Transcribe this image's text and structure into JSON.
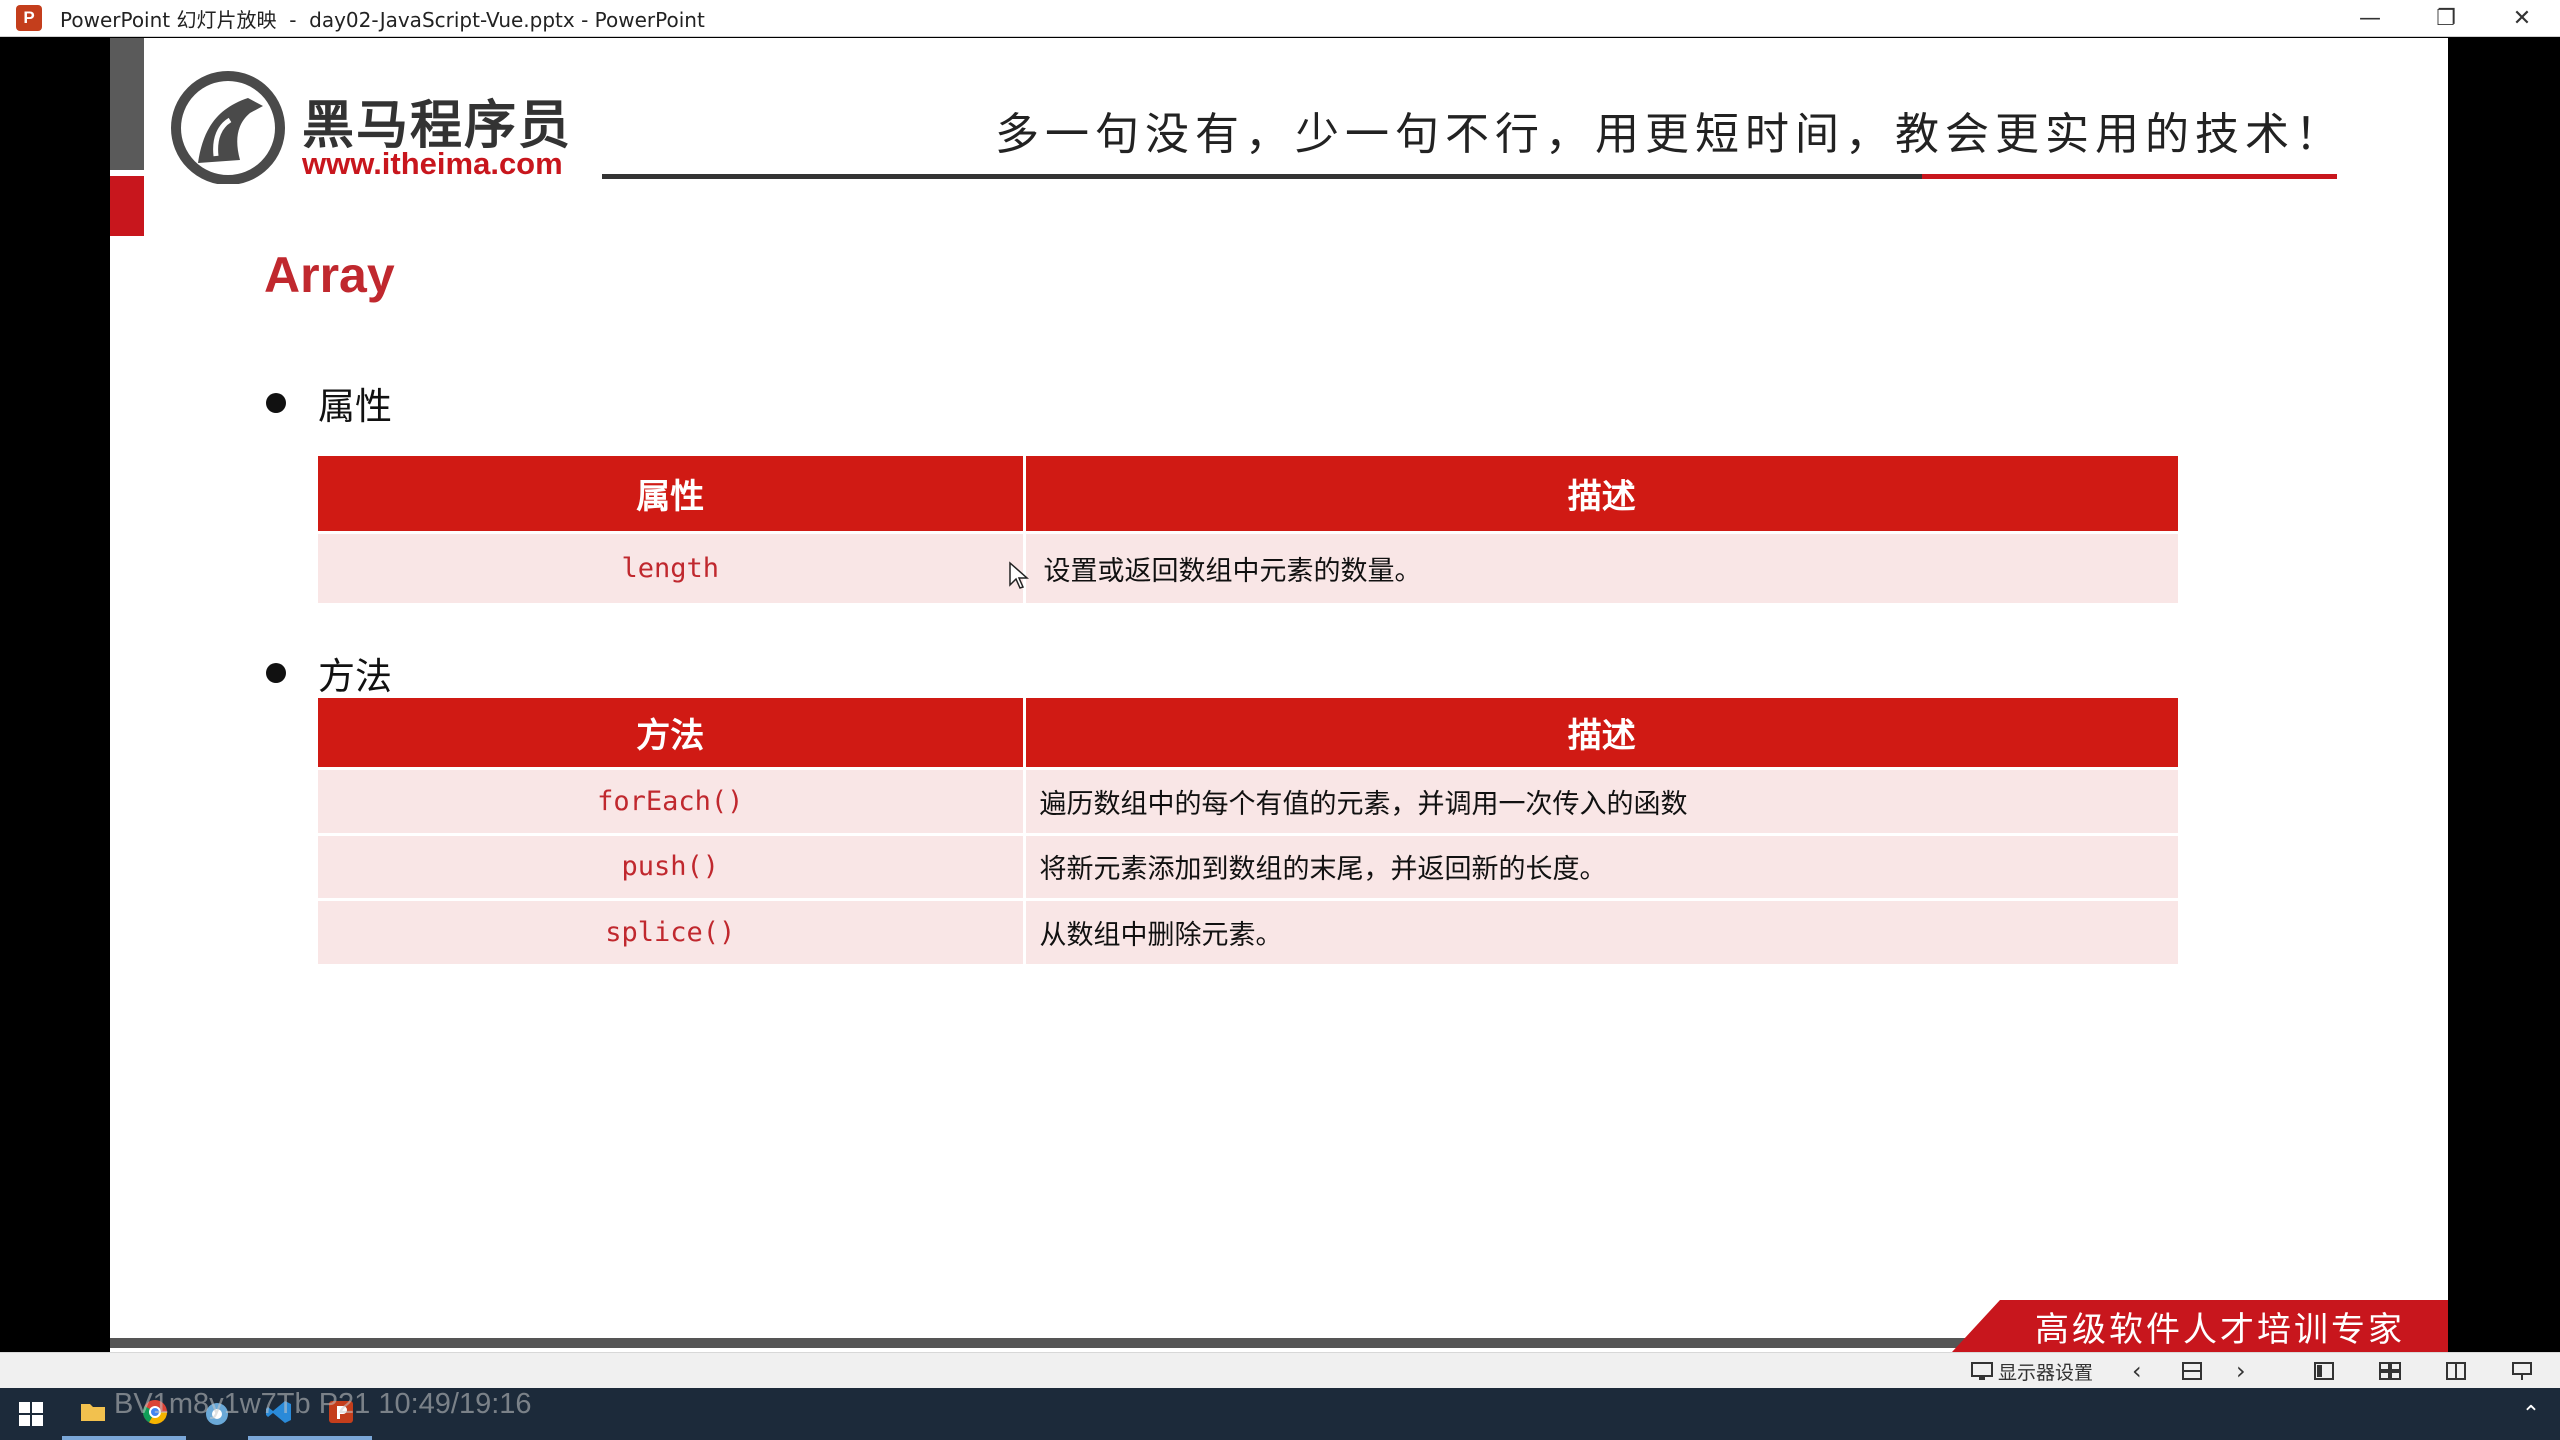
{
  "window": {
    "app_badge": "P",
    "title": "PowerPoint 幻灯片放映  -  day02-JavaScript-Vue.pptx - PowerPoint",
    "minimize": "—",
    "restore": "❐",
    "close": "✕"
  },
  "slide": {
    "brand_cn": "黑马程序员",
    "brand_url": "www.itheima.com",
    "slogan": "多一句没有，少一句不行，用更短时间，教会更实用的技术！",
    "title": "Array",
    "bullet1": "属性",
    "bullet2": "方法",
    "properties_table": {
      "headers": [
        "属性",
        "描述"
      ],
      "rows": [
        {
          "name": "length",
          "desc": "设置或返回数组中元素的数量。"
        }
      ]
    },
    "methods_table": {
      "headers": [
        "方法",
        "描述"
      ],
      "rows": [
        {
          "name": "forEach()",
          "desc": "遍历数组中的每个有值的元素，并调用一次传入的函数"
        },
        {
          "name": "push()",
          "desc": "将新元素添加到数组的末尾，并返回新的长度。"
        },
        {
          "name": "splice()",
          "desc": "从数组中删除元素。"
        }
      ]
    },
    "footer_banner": "高级软件人才培训专家"
  },
  "toolbar": {
    "display_settings": "显示器设置"
  },
  "video_overlay": "BV1m8y1w7Tb  P21 10:49/19:16",
  "colors": {
    "brand_red": "#c8161d",
    "header_red": "#d01a14",
    "row_bg": "#f9e6e6"
  }
}
